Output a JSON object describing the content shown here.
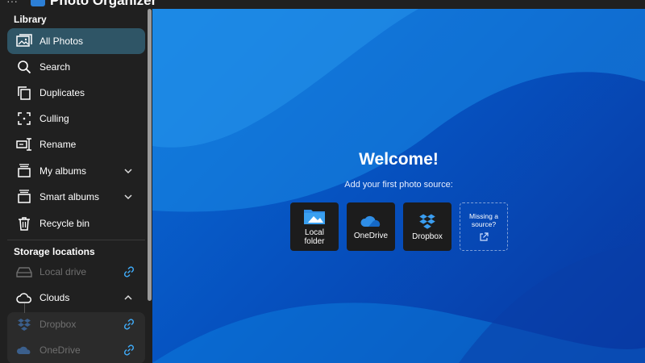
{
  "app": {
    "title": "Photo Organizer"
  },
  "sidebar": {
    "library_header": "Library",
    "items": [
      {
        "label": "All Photos",
        "icon": "photos-icon"
      },
      {
        "label": "Search",
        "icon": "search-icon"
      },
      {
        "label": "Duplicates",
        "icon": "duplicates-icon"
      },
      {
        "label": "Culling",
        "icon": "culling-icon"
      },
      {
        "label": "Rename",
        "icon": "rename-icon"
      },
      {
        "label": "My albums",
        "icon": "album-icon"
      },
      {
        "label": "Smart albums",
        "icon": "smart-album-icon"
      },
      {
        "label": "Recycle bin",
        "icon": "recycle-bin-icon"
      }
    ],
    "storage_header": "Storage locations",
    "storage": [
      {
        "label": "Local drive",
        "icon": "drive-icon"
      },
      {
        "label": "Clouds",
        "icon": "cloud-icon"
      },
      {
        "label": "Dropbox",
        "icon": "dropbox-icon"
      },
      {
        "label": "OneDrive",
        "icon": "onedrive-icon"
      }
    ]
  },
  "main": {
    "welcome": "Welcome!",
    "subtitle": "Add your first photo source:",
    "sources": [
      {
        "label_line1": "Local",
        "label_line2": "folder"
      },
      {
        "label": "OneDrive"
      },
      {
        "label": "Dropbox"
      },
      {
        "label_line1": "Missing a",
        "label_line2": "source?"
      }
    ]
  },
  "colors": {
    "accent_active": "#2f5566",
    "link_blue": "#3fa9f5",
    "background_blue": "#0652c0"
  }
}
